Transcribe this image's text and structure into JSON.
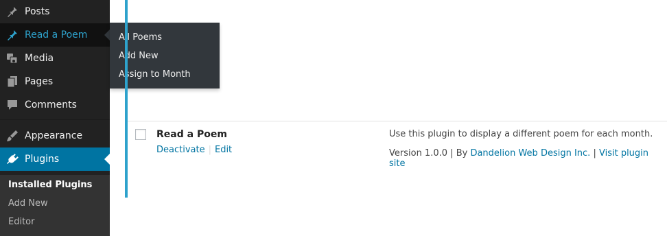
{
  "sidebar": {
    "items": [
      {
        "label": "Posts",
        "icon": "pin-icon"
      },
      {
        "label": "Read a Poem",
        "icon": "pin-icon"
      },
      {
        "label": "Media",
        "icon": "media-icon"
      },
      {
        "label": "Pages",
        "icon": "pages-icon"
      },
      {
        "label": "Comments",
        "icon": "comments-icon"
      },
      {
        "label": "Appearance",
        "icon": "brush-icon"
      },
      {
        "label": "Plugins",
        "icon": "plug-icon"
      }
    ],
    "submenu": [
      "Installed Plugins",
      "Add New",
      "Editor"
    ]
  },
  "flyout": [
    "All Poems",
    "Add New",
    "Assign to Month"
  ],
  "plugin": {
    "name": "Read a Poem",
    "actions": [
      "Deactivate",
      "Edit"
    ],
    "action_separator": "|",
    "description": "Use this plugin to display a different poem for each month.",
    "version_text": "Version 1.0.0",
    "by_text": "By",
    "author": "Dandelion Web Design Inc.",
    "site_link": "Visit plugin site",
    "meta_separator": "|"
  },
  "colors": {
    "sidebar_bg": "#222222",
    "accent": "#0074a2",
    "hover_accent": "#2ea2cc",
    "row_border": "#2ea2cc"
  }
}
